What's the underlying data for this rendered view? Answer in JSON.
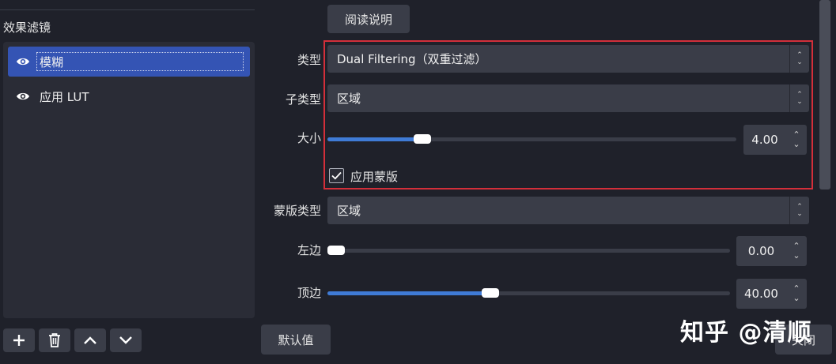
{
  "left": {
    "title": "效果滤镜",
    "filters": [
      {
        "label": "模糊",
        "selected": true,
        "icon": "eye-icon"
      },
      {
        "label": "应用 LUT",
        "selected": false,
        "icon": "eye-icon"
      }
    ],
    "toolbar": {
      "icons": [
        "plus-icon",
        "trash-icon",
        "chevron-up-icon",
        "chevron-down-icon"
      ]
    }
  },
  "right": {
    "readme_label": "阅读说明",
    "type": {
      "label": "类型",
      "value": "Dual Filtering（双重过滤）"
    },
    "subtype": {
      "label": "子类型",
      "value": "区域"
    },
    "size": {
      "label": "大小",
      "value": "4.00",
      "fraction": 0.22
    },
    "apply_mask": {
      "label": "应用蒙版",
      "checked": true
    },
    "mask_type": {
      "label": "蒙版类型",
      "value": "区域"
    },
    "left_edge": {
      "label": "左边",
      "value": "0.00",
      "fraction": 0.0
    },
    "top_edge": {
      "label": "顶边",
      "value": "40.00",
      "fraction": 0.4
    },
    "defaults_label": "默认值",
    "close_label": "关闭"
  },
  "colors": {
    "accent": "#3f7bd6",
    "selection": "#3454b4",
    "highlight_border": "#d32f3a",
    "background": "#1f212a"
  },
  "watermark": "知乎 @清顺"
}
